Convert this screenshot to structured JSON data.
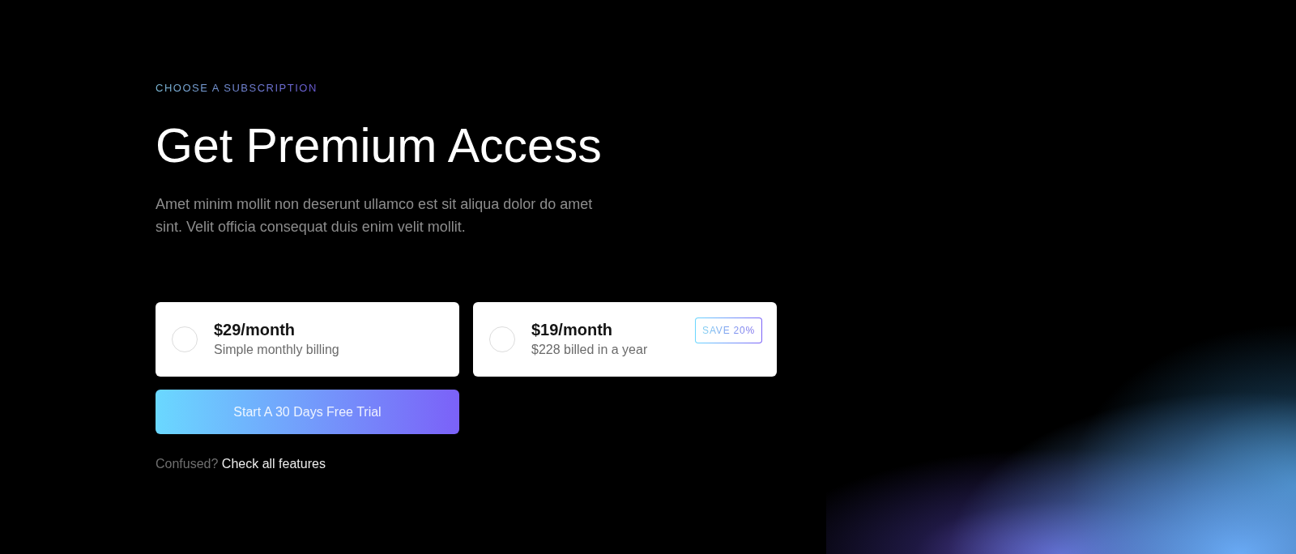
{
  "eyebrow": "CHOOSE A SUBSCRIPTION",
  "title": "Get Premium Access",
  "description": "Amet minim mollit non deserunt ullamco est sit aliqua dolor do amet sint. Velit officia consequat duis enim velit mollit.",
  "plans": [
    {
      "price": "$29/month",
      "note": "Simple monthly billing",
      "selected": false
    },
    {
      "price": "$19/month",
      "note": "$228 billed in a year",
      "selected": false,
      "badge": "SAVE 20%"
    }
  ],
  "cta": {
    "label": "Start A 30 Days Free Trial"
  },
  "footer": {
    "prompt": "Confused?",
    "link": "Check all features"
  }
}
